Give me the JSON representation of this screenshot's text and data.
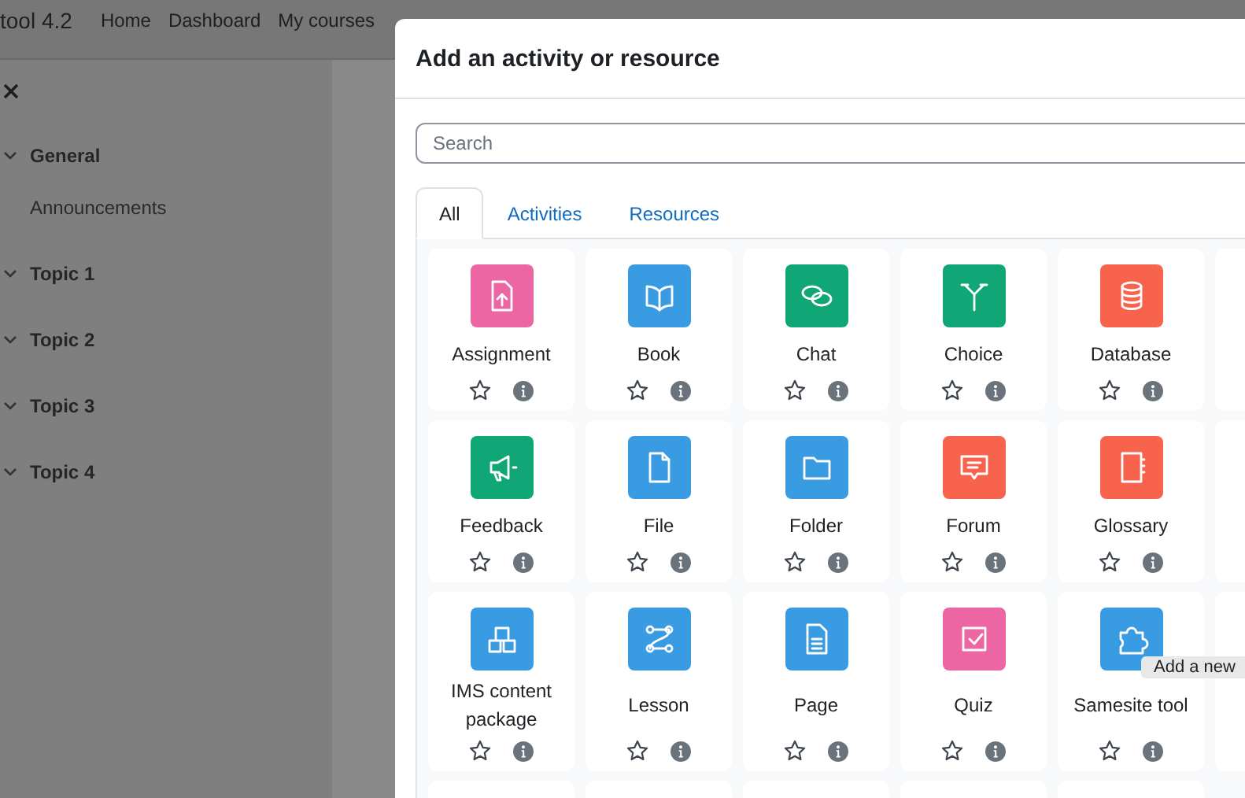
{
  "navbar": {
    "site_name": "tool 4.2",
    "links": [
      "Home",
      "Dashboard",
      "My courses"
    ]
  },
  "drawer": {
    "sections": [
      {
        "title": "General",
        "expanded": true,
        "children": [
          {
            "title": "Announcements"
          }
        ]
      },
      {
        "title": "Topic 1",
        "expanded": true
      },
      {
        "title": "Topic 2",
        "expanded": true
      },
      {
        "title": "Topic 3",
        "expanded": true
      },
      {
        "title": "Topic 4",
        "expanded": true
      }
    ]
  },
  "modal": {
    "title": "Add an activity or resource",
    "search": {
      "placeholder": "Search"
    },
    "tabs": [
      {
        "label": "All",
        "selected": true
      },
      {
        "label": "Activities",
        "selected": false
      },
      {
        "label": "Resources",
        "selected": false
      }
    ],
    "items": [
      {
        "name": "Assignment",
        "color": "#eb66a2",
        "starred": false
      },
      {
        "name": "Book",
        "color": "#399be2",
        "starred": false
      },
      {
        "name": "Chat",
        "color": "#11a676",
        "starred": false
      },
      {
        "name": "Choice",
        "color": "#11a676",
        "starred": false
      },
      {
        "name": "Database",
        "color": "#f7634d",
        "starred": false
      },
      {
        "name": "Feedback",
        "color": "#11a676",
        "starred": false
      },
      {
        "name": "File",
        "color": "#399be2",
        "starred": false
      },
      {
        "name": "Folder",
        "color": "#399be2",
        "starred": false
      },
      {
        "name": "Forum",
        "color": "#f7634d",
        "starred": false
      },
      {
        "name": "Glossary",
        "color": "#f7634d",
        "starred": false
      },
      {
        "name": "IMS content package",
        "color": "#399be2",
        "starred": false
      },
      {
        "name": "Lesson",
        "color": "#399be2",
        "starred": false
      },
      {
        "name": "Page",
        "color": "#399be2",
        "starred": false
      },
      {
        "name": "Quiz",
        "color": "#eb66a2",
        "starred": false
      },
      {
        "name": "Samesite tool",
        "color": "#399be2",
        "starred": false
      }
    ],
    "tooltip": "Add a new"
  }
}
